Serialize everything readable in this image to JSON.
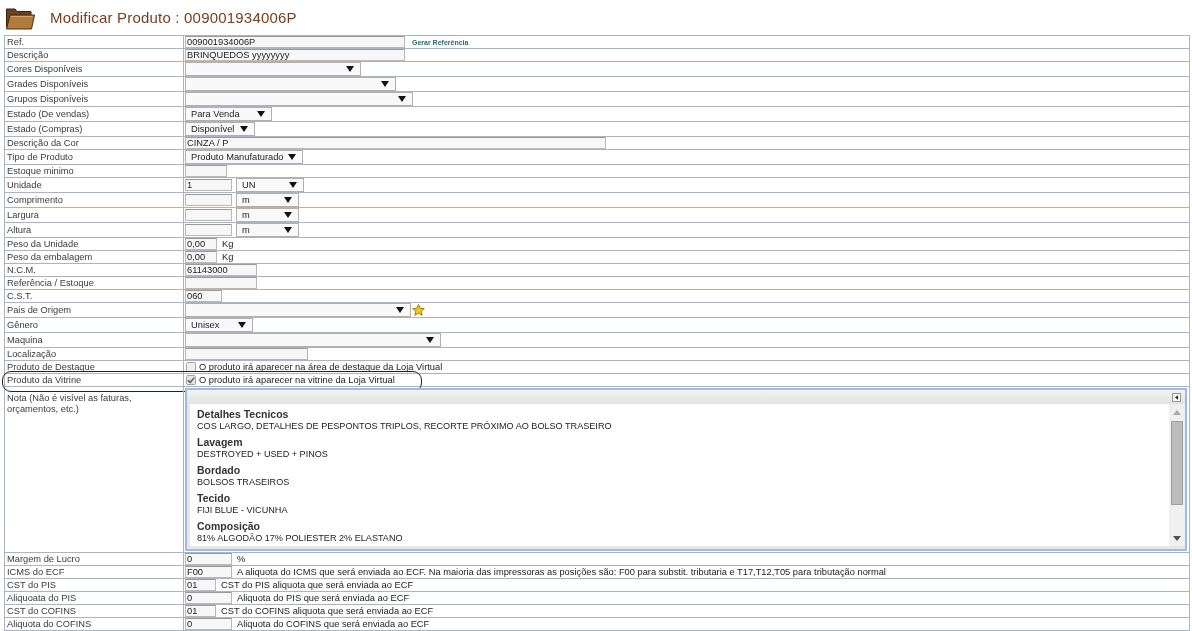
{
  "header": {
    "title": "Modificar Produto : 009001934006P"
  },
  "form": {
    "rows": [
      {
        "label": "Ref.",
        "circled": false,
        "controls": [
          {
            "kind": "text",
            "value": "009001934006P"
          },
          {
            "kind": "link",
            "text": "Gerar Referência"
          }
        ]
      },
      {
        "label": "Descrição",
        "circled": false,
        "controls": [
          {
            "kind": "text",
            "value": "BRINQUEDOS yyyyyyyy"
          }
        ]
      },
      {
        "label": "Cores Disponíveis",
        "circled": false,
        "controls": [
          {
            "kind": "select"
          }
        ]
      },
      {
        "label": "Grades Disponíveis",
        "circled": false,
        "controls": [
          {
            "kind": "select"
          }
        ]
      },
      {
        "label": "Grupos Disponíveis",
        "circled": false,
        "controls": [
          {
            "kind": "select"
          }
        ]
      },
      {
        "label": "Estado (De vendas)",
        "circled": false,
        "controls": [
          {
            "kind": "select",
            "value": "Para Venda"
          }
        ]
      },
      {
        "label": "Estado (Compras)",
        "circled": false,
        "controls": [
          {
            "kind": "select",
            "value": "Disponível"
          }
        ]
      },
      {
        "label": "Descrição da Cor",
        "circled": false,
        "controls": [
          {
            "kind": "text",
            "value": "CINZA / P"
          }
        ]
      },
      {
        "label": "Tipo de Produto",
        "circled": false,
        "controls": [
          {
            "kind": "select",
            "value": "Produto Manufaturado"
          }
        ]
      },
      {
        "label": "Estoque minimo",
        "circled": false,
        "controls": [
          {
            "kind": "text"
          }
        ]
      },
      {
        "label": "Unidade",
        "circled": false,
        "controls": [
          {
            "kind": "text",
            "value": "1"
          },
          {
            "kind": "select",
            "value": "UN"
          }
        ]
      },
      {
        "label": "Comprimento",
        "circled": false,
        "controls": [
          {
            "kind": "text"
          },
          {
            "kind": "select",
            "value": "m"
          }
        ]
      },
      {
        "label": "Largura",
        "circled": false,
        "controls": [
          {
            "kind": "text"
          },
          {
            "kind": "select",
            "value": "m"
          }
        ]
      },
      {
        "label": "Altura",
        "circled": false,
        "controls": [
          {
            "kind": "text"
          },
          {
            "kind": "select",
            "value": "m"
          }
        ]
      },
      {
        "label": "Peso da Unidade",
        "circled": false,
        "controls": [
          {
            "kind": "text",
            "value": "0,00"
          },
          {
            "kind": "unit",
            "text": "Kg"
          }
        ]
      },
      {
        "label": "Peso da embalagem",
        "circled": false,
        "controls": [
          {
            "kind": "text",
            "value": "0,00"
          },
          {
            "kind": "unit",
            "text": "Kg"
          }
        ]
      },
      {
        "label": "N.C.M.",
        "circled": false,
        "controls": [
          {
            "kind": "text",
            "value": "61143000"
          }
        ]
      },
      {
        "label": "Referência / Estoque",
        "circled": false,
        "controls": [
          {
            "kind": "text"
          }
        ]
      },
      {
        "label": "C.S.T.",
        "circled": false,
        "controls": [
          {
            "kind": "text",
            "value": "060"
          }
        ]
      },
      {
        "label": "Pais de Origem",
        "circled": false,
        "controls": [
          {
            "kind": "select"
          }
        ]
      },
      {
        "label": "Gênero",
        "circled": false,
        "controls": [
          {
            "kind": "select",
            "value": "Unisex"
          }
        ]
      },
      {
        "label": "Maquina",
        "circled": false,
        "controls": [
          {
            "kind": "select"
          }
        ]
      },
      {
        "label": "Localização",
        "circled": false,
        "controls": [
          {
            "kind": "text"
          }
        ]
      },
      {
        "label": "Produto de Destaque",
        "circled": false,
        "controls": [
          {
            "kind": "checkbox",
            "checked": false,
            "label": "O produto irá aparecer na área de destaque da Loja Virtual"
          }
        ]
      },
      {
        "label": "Produto da Vitrine",
        "circled": true,
        "controls": [
          {
            "kind": "checkbox",
            "checked": true,
            "label": "O produto irá aparecer na vitrine da Loja Virtual"
          }
        ]
      },
      {
        "label": "Nota (Não é visível as faturas, orçamentos, etc.)",
        "circled": false,
        "controls": [
          {
            "kind": "editor",
            "sections": [
              {
                "heading": "Detalhes Tecnicos",
                "text": "COS LARGO, DETALHES DE PESPONTOS TRIPLOS, RECORTE PRÓXIMO AO BOLSO TRASEIRO"
              },
              {
                "heading": "Lavagem",
                "text": "DESTROYED + USED + PINOS"
              },
              {
                "heading": "Bordado",
                "text": "BOLSOS TRASEIROS"
              },
              {
                "heading": "Tecido",
                "text": "FIJI BLUE - VICUNHA"
              },
              {
                "heading": "Composição",
                "text": "81% ALGODÃO 17% POLIESTER 2% ELASTANO"
              }
            ]
          }
        ]
      },
      {
        "label": "Margem de Lucro",
        "circled": false,
        "controls": [
          {
            "kind": "text",
            "value": "0"
          },
          {
            "kind": "unit",
            "text": "%"
          }
        ]
      },
      {
        "label": "ICMS do ECF",
        "circled": false,
        "controls": [
          {
            "kind": "text",
            "value": "F00"
          },
          {
            "kind": "hint",
            "text": "A aliquota do ICMS que será enviada ao ECF. Na maioria das impressoras as posições são: F00 para substit. tributaria e T17,T12,T05 para tributação normal"
          }
        ]
      },
      {
        "label": "CST do PIS",
        "circled": false,
        "controls": [
          {
            "kind": "text",
            "value": "01"
          },
          {
            "kind": "hint",
            "text": "CST do PIS aliquota que será enviada ao ECF"
          }
        ]
      },
      {
        "label": "Aliquoata do PIS",
        "circled": false,
        "controls": [
          {
            "kind": "text",
            "value": "0"
          },
          {
            "kind": "hint",
            "text": "Aliquota do PIS que será enviada ao ECF"
          }
        ]
      },
      {
        "label": "CST do COFINS",
        "circled": false,
        "controls": [
          {
            "kind": "text",
            "value": "01"
          },
          {
            "kind": "hint",
            "text": "CST do COFINS aliquota que será enviada ao ECF"
          }
        ]
      },
      {
        "label": "Aliquota do COFINS",
        "circled": false,
        "controls": [
          {
            "kind": "text",
            "value": "0"
          },
          {
            "kind": "hint",
            "text": "Aliquota do COFINS que será enviada ao ECF"
          }
        ]
      }
    ]
  }
}
